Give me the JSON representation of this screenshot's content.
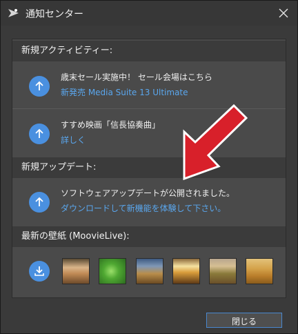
{
  "window": {
    "title": "通知センター"
  },
  "sections": {
    "activity": {
      "header": "新規アクティビティー:",
      "items": [
        {
          "title": "歳末セール実施中！ セール会場はこちら",
          "link": "新発売 Media Suite 13 Ultimate"
        },
        {
          "title": "すすめ映画「信長協奏曲」",
          "link": "詳しく"
        }
      ]
    },
    "updates": {
      "header": "新規アップデート:",
      "items": [
        {
          "title": "ソフトウェアアップデートが公開されました。",
          "link": "ダウンロードして新機能を体験して下さい。"
        }
      ]
    },
    "wallpaper": {
      "header": "最新の壁紙 (MoovieLive):"
    }
  },
  "footer": {
    "close_label": "閉じる"
  },
  "colors": {
    "accent": "#4a90e0",
    "link": "#5aa7ee",
    "arrow": "#d8202a"
  }
}
